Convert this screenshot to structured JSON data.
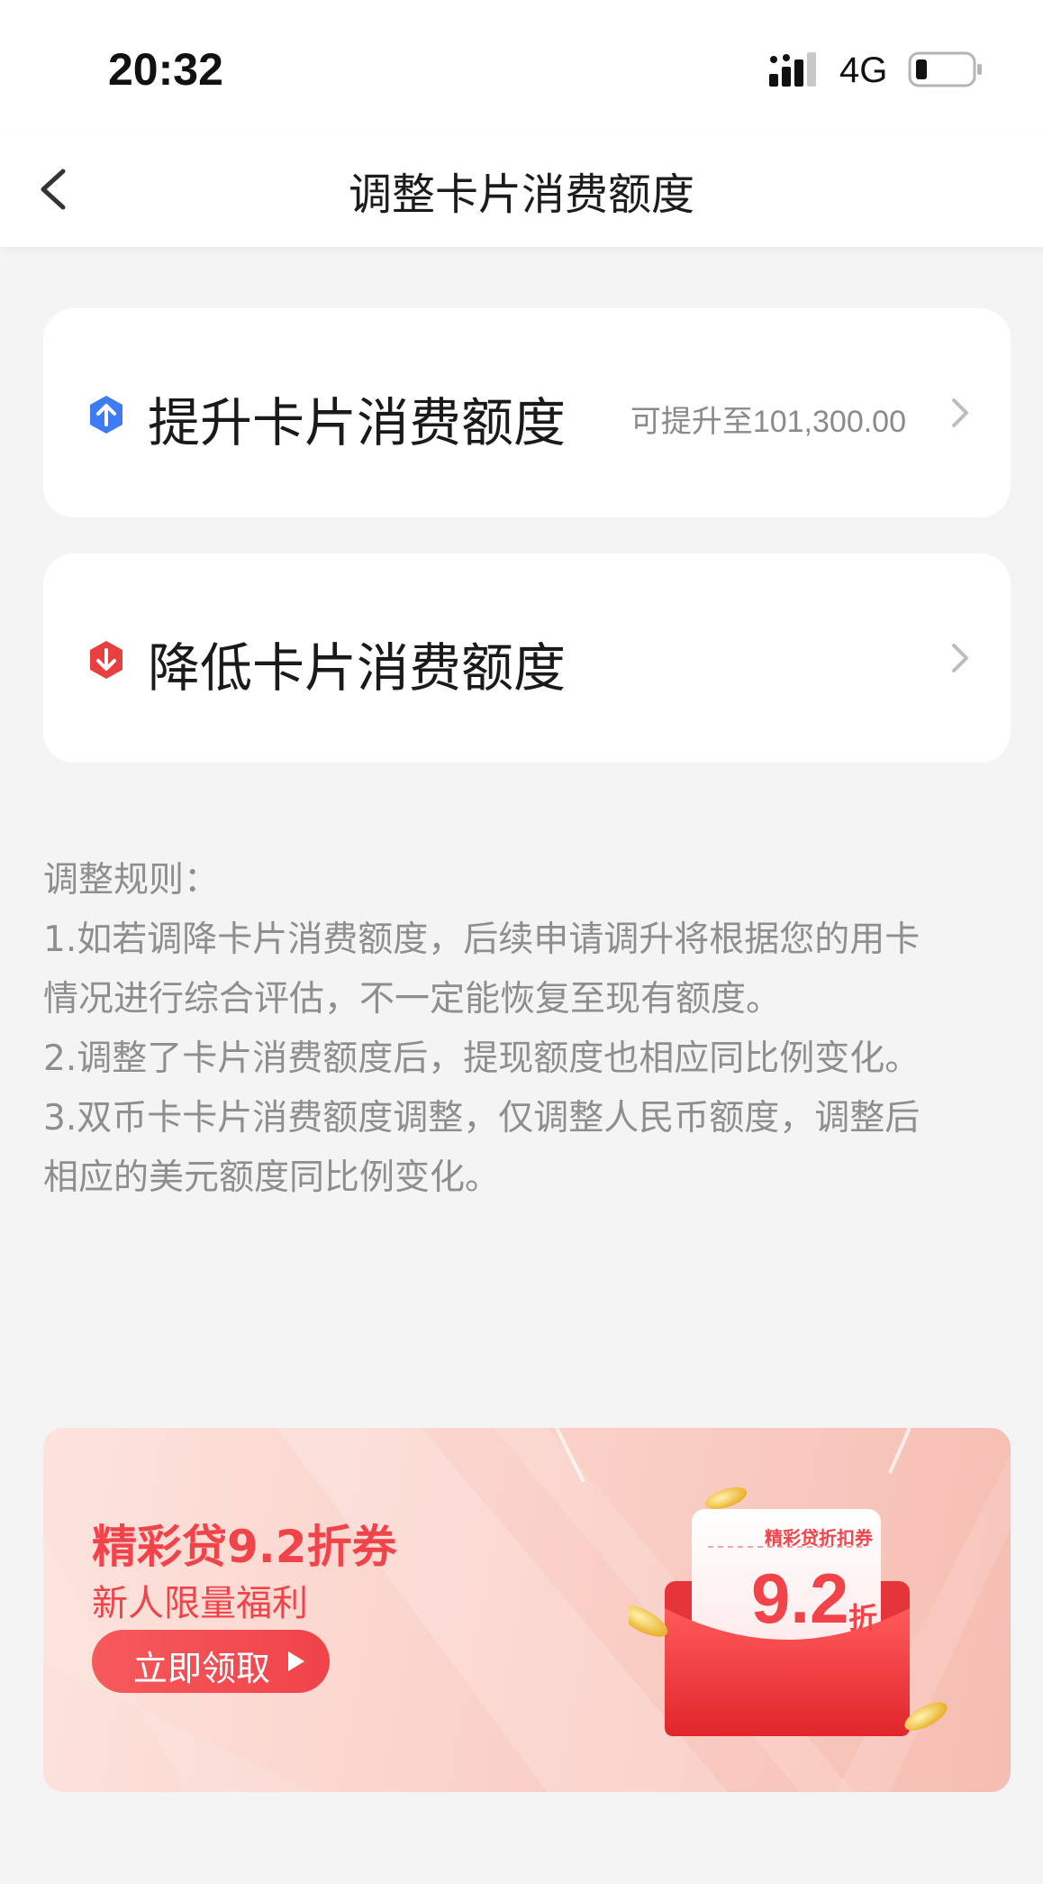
{
  "status_bar": {
    "time": "20:32",
    "network": "4G",
    "signal_icon": "signal-bars-icon",
    "battery_icon": "battery-low-icon"
  },
  "nav": {
    "back_icon": "chevron-left-icon",
    "title": "调整卡片消费额度"
  },
  "options": [
    {
      "label": "提升卡片消费额度",
      "hint": "可提升至101,300.00",
      "icon": "arrow-up-hexagon-icon",
      "icon_color": "#3d7cf5"
    },
    {
      "label": "降低卡片消费额度",
      "hint": "",
      "icon": "arrow-down-hexagon-icon",
      "icon_color": "#e84040"
    }
  ],
  "rules": {
    "heading": "调整规则：",
    "lines": [
      "1.如若调降卡片消费额度，后续申请调升将根据您的用卡",
      "情况进行综合评估，不一定能恢复至现有额度。",
      "2.调整了卡片消费额度后，提现额度也相应同比例变化。",
      "3.双币卡卡片消费额度调整，仅调整人民币额度，调整后",
      "相应的美元额度同比例变化。"
    ]
  },
  "banner": {
    "title": "精彩贷9.2折券",
    "subtitle": "新人限量福利",
    "button_label": "立即领取",
    "coupon_heading": "精彩贷折扣券",
    "coupon_value": "9.2",
    "coupon_unit": "折",
    "accent_color": "#f0434a"
  }
}
